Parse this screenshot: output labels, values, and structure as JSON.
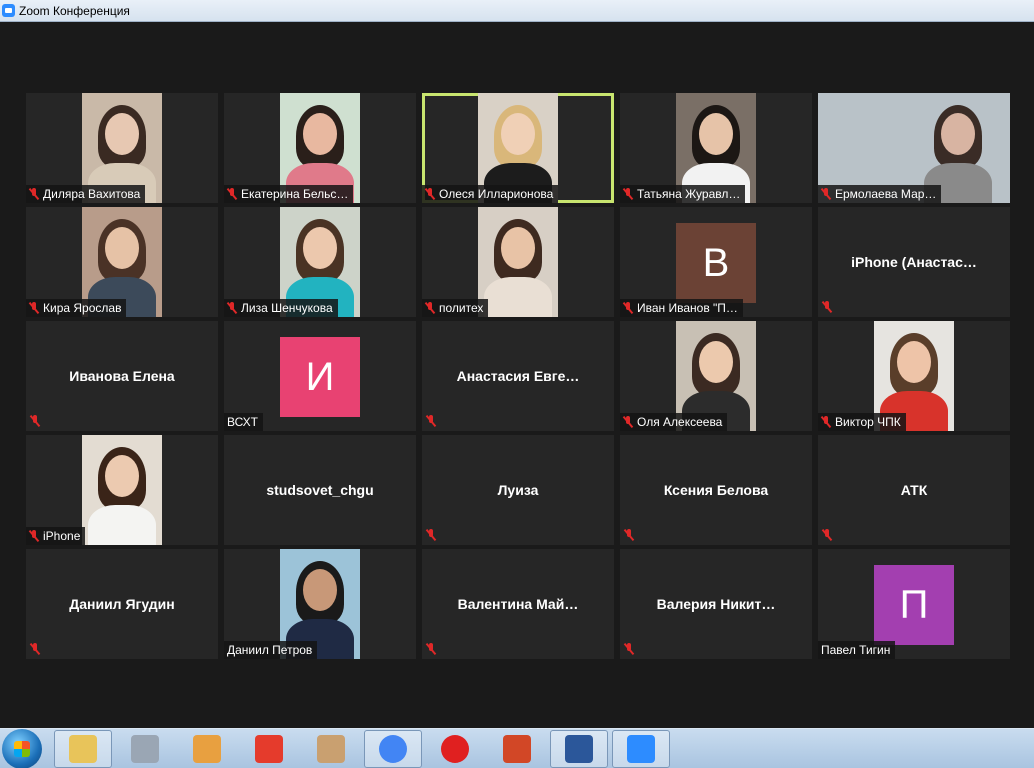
{
  "window": {
    "title": "Zoom Конференция"
  },
  "participants": [
    {
      "name": "Диляра Вахитова",
      "kind": "video",
      "palette": [
        "#c9b9a8",
        "#e7c8b2",
        "#3a2a22",
        "#d8cbb8"
      ]
    },
    {
      "name": "Екатерина Бельс…",
      "kind": "video",
      "palette": [
        "#cfe0d0",
        "#e8b8a0",
        "#2a1f1a",
        "#e07a8a"
      ]
    },
    {
      "name": "Олеся Илларионова",
      "kind": "video",
      "active": true,
      "palette": [
        "#d9d1c6",
        "#f0d0b6",
        "#d9b77a",
        "#1c1c1c"
      ]
    },
    {
      "name": "Татьяна Журавл…",
      "kind": "video",
      "palette": [
        "#7a6f66",
        "#e6c3a8",
        "#1c1714",
        "#f2f2f2"
      ]
    },
    {
      "name": "Ермолаева Мар…",
      "kind": "video-wide",
      "palette": [
        "#b9c2c8",
        "#d8b4a2",
        "#3a2c26",
        "#8a8a8a"
      ]
    },
    {
      "name": "Кира Ярослав",
      "kind": "video",
      "palette": [
        "#b89c8a",
        "#e6c2a6",
        "#4a3226",
        "#3c4a5a"
      ]
    },
    {
      "name": "Лиза Шенчукова",
      "kind": "video",
      "palette": [
        "#cdd3c9",
        "#ecc8ad",
        "#4a3324",
        "#22b3c0"
      ]
    },
    {
      "name": "политех",
      "kind": "video",
      "palette": [
        "#d7cfc5",
        "#e8c3a6",
        "#3e2a20",
        "#e9dfd4"
      ]
    },
    {
      "name": "Иван Иванов \"П…",
      "kind": "avatar",
      "letter": "В",
      "color": "#6b4235"
    },
    {
      "name": "iPhone (Анастас…",
      "kind": "name-only"
    },
    {
      "name": "Иванова Елена",
      "kind": "name-only"
    },
    {
      "name": "ВСХТ",
      "kind": "avatar",
      "letter": "И",
      "color": "#e84272",
      "nomic": true
    },
    {
      "name": "Анастасия Евге…",
      "kind": "name-only"
    },
    {
      "name": "Оля Алексеева",
      "kind": "video",
      "palette": [
        "#c8c0b4",
        "#ecc9ad",
        "#3b2a22",
        "#2c2c2c"
      ]
    },
    {
      "name": "Виктор ЧПК",
      "kind": "video",
      "palette": [
        "#e6e4e0",
        "#eec4a8",
        "#5a3e2a",
        "#d8332b"
      ]
    },
    {
      "name": "iPhone",
      "kind": "video",
      "palette": [
        "#e3dcd2",
        "#eccab0",
        "#3a2418",
        "#f4f4f2"
      ]
    },
    {
      "name": "studsovet_chgu",
      "kind": "name-only",
      "nomic": true
    },
    {
      "name": "Луиза",
      "kind": "name-only"
    },
    {
      "name": "Ксения Белова",
      "kind": "name-only"
    },
    {
      "name": "АТК",
      "kind": "name-only"
    },
    {
      "name": "Даниил Ягудин",
      "kind": "name-only"
    },
    {
      "name": "Даниил Петров",
      "kind": "video",
      "nomic": true,
      "palette": [
        "#9cc3d8",
        "#c89878",
        "#1a1a1a",
        "#1f2a44"
      ]
    },
    {
      "name": "Валентина Май…",
      "kind": "name-only"
    },
    {
      "name": "Валерия Никит…",
      "kind": "name-only"
    },
    {
      "name": "Павел Тигин",
      "kind": "avatar",
      "letter": "П",
      "color": "#a33fb0",
      "nomic": true
    }
  ],
  "taskbar": {
    "items": [
      {
        "name": "explorer",
        "icon": "folder-icon",
        "color": "#e8c45a",
        "pinned": true
      },
      {
        "name": "calculator",
        "icon": "calculator-icon",
        "color": "#9aa6b4"
      },
      {
        "name": "media-player",
        "icon": "media-player-icon",
        "color": "#e8a040"
      },
      {
        "name": "yandex",
        "icon": "yandex-icon",
        "color": "#e53b2c"
      },
      {
        "name": "paint",
        "icon": "paint-icon",
        "color": "#c9a070"
      },
      {
        "name": "chrome",
        "icon": "chrome-icon",
        "color": "#4285f4",
        "pinned": true
      },
      {
        "name": "yandex-browser",
        "icon": "yandex-browser-icon",
        "color": "#e02020"
      },
      {
        "name": "powerpoint",
        "icon": "powerpoint-icon",
        "color": "#d24726"
      },
      {
        "name": "word",
        "icon": "word-icon",
        "color": "#2b579a",
        "pinned": true
      },
      {
        "name": "zoom",
        "icon": "zoom-icon",
        "color": "#2d8cff",
        "pinned": true
      }
    ]
  }
}
